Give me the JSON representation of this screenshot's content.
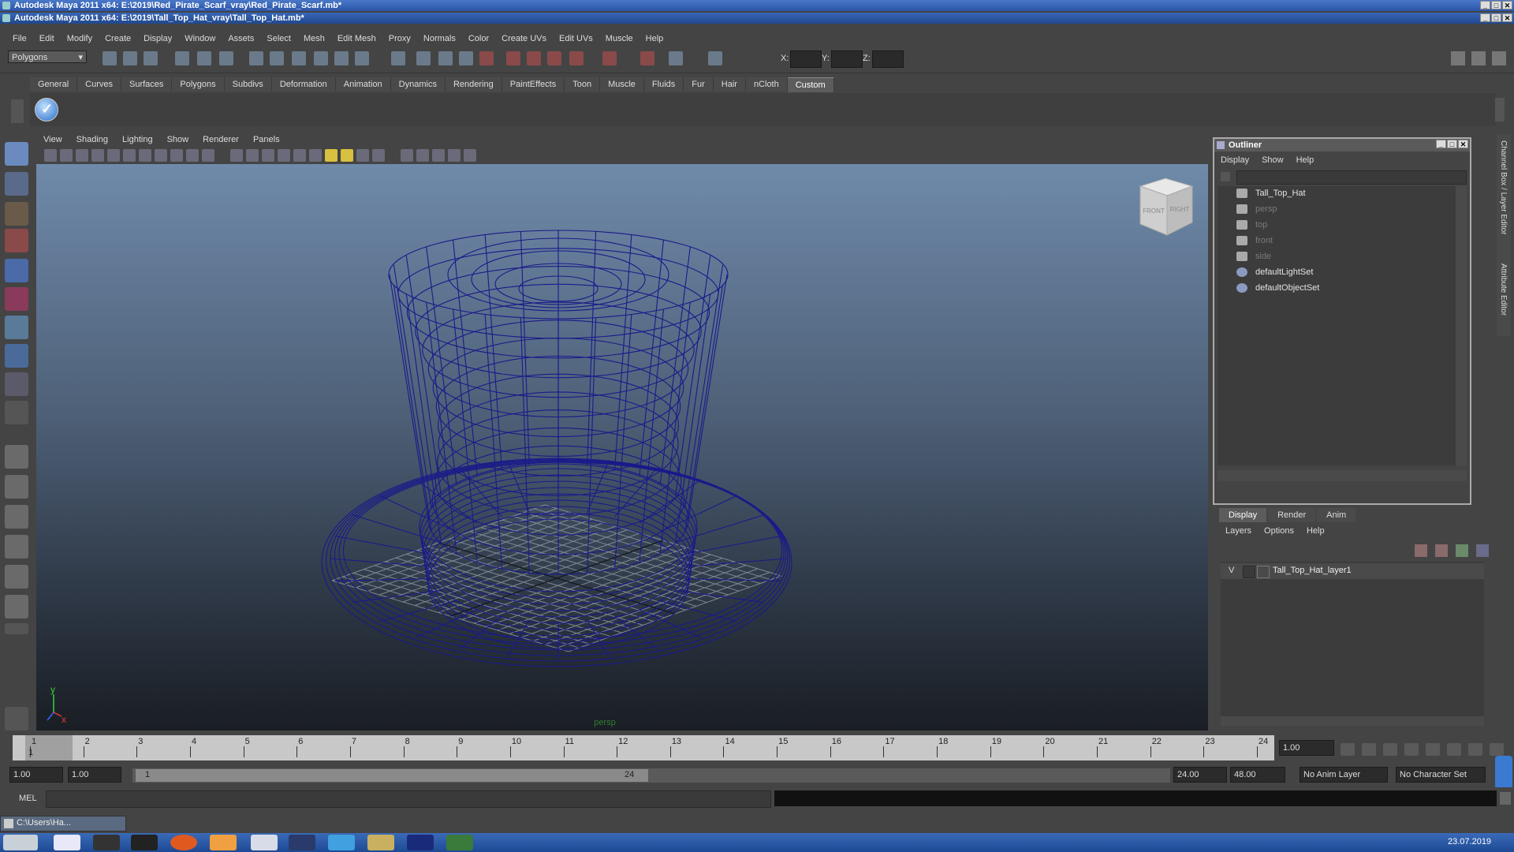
{
  "windows": {
    "back_title": "Autodesk Maya 2011 x64: E:\\2019\\Red_Pirate_Scarf_vray\\Red_Pirate_Scarf.mb*",
    "front_title": "Autodesk Maya 2011 x64: E:\\2019\\Tall_Top_Hat_vray\\Tall_Top_Hat.mb*"
  },
  "menubar": [
    "File",
    "Edit",
    "Modify",
    "Create",
    "Display",
    "Window",
    "Assets",
    "Select",
    "Mesh",
    "Edit Mesh",
    "Proxy",
    "Normals",
    "Color",
    "Create UVs",
    "Edit UVs",
    "Muscle",
    "Help"
  ],
  "status_line": {
    "mode": "Polygons",
    "x_label": "X:",
    "y_label": "Y:",
    "z_label": "Z:"
  },
  "shelf": {
    "tabs": [
      "General",
      "Curves",
      "Surfaces",
      "Polygons",
      "Subdivs",
      "Deformation",
      "Animation",
      "Dynamics",
      "Rendering",
      "PaintEffects",
      "Toon",
      "Muscle",
      "Fluids",
      "Fur",
      "Hair",
      "nCloth",
      "Custom"
    ],
    "active": "Custom"
  },
  "viewport": {
    "menu": [
      "View",
      "Shading",
      "Lighting",
      "Show",
      "Renderer",
      "Panels"
    ],
    "camera_label": "persp",
    "viewcube_front": "FRONT",
    "viewcube_right": "RIGHT",
    "axis_y": "y",
    "axis_x": "x",
    "wire_color": "#1a1a8a"
  },
  "outliner": {
    "title": "Outliner",
    "menu": [
      "Display",
      "Show",
      "Help"
    ],
    "items": [
      {
        "label": "Tall_Top_Hat",
        "dim": false
      },
      {
        "label": "persp",
        "dim": true
      },
      {
        "label": "top",
        "dim": true
      },
      {
        "label": "front",
        "dim": true
      },
      {
        "label": "side",
        "dim": true
      },
      {
        "label": "defaultLightSet",
        "dim": false
      },
      {
        "label": "defaultObjectSet",
        "dim": false
      }
    ]
  },
  "side_tabs": {
    "channel_box": "Channel Box / Layer Editor",
    "attribute_editor": "Attribute Editor"
  },
  "layer_editor": {
    "tabs": [
      "Display",
      "Render",
      "Anim"
    ],
    "active": "Display",
    "menu": [
      "Layers",
      "Options",
      "Help"
    ],
    "layer_visible": "V",
    "layer_name": "Tall_Top_Hat_layer1"
  },
  "timeline": {
    "start": 1,
    "end": 24,
    "current_frame": "1",
    "current_time": "1.00"
  },
  "range": {
    "start_time": "1.00",
    "playback_start": "1.00",
    "range_start_label": "1",
    "range_end_label": "24",
    "playback_end": "24.00",
    "end_time": "48.00",
    "anim_layer": "No Anim Layer",
    "char_set": "No Character Set"
  },
  "command_line": {
    "label": "MEL"
  },
  "taskbar": {
    "minimized_window": "C:\\Users\\Ha...",
    "date": "23.07.2019"
  }
}
